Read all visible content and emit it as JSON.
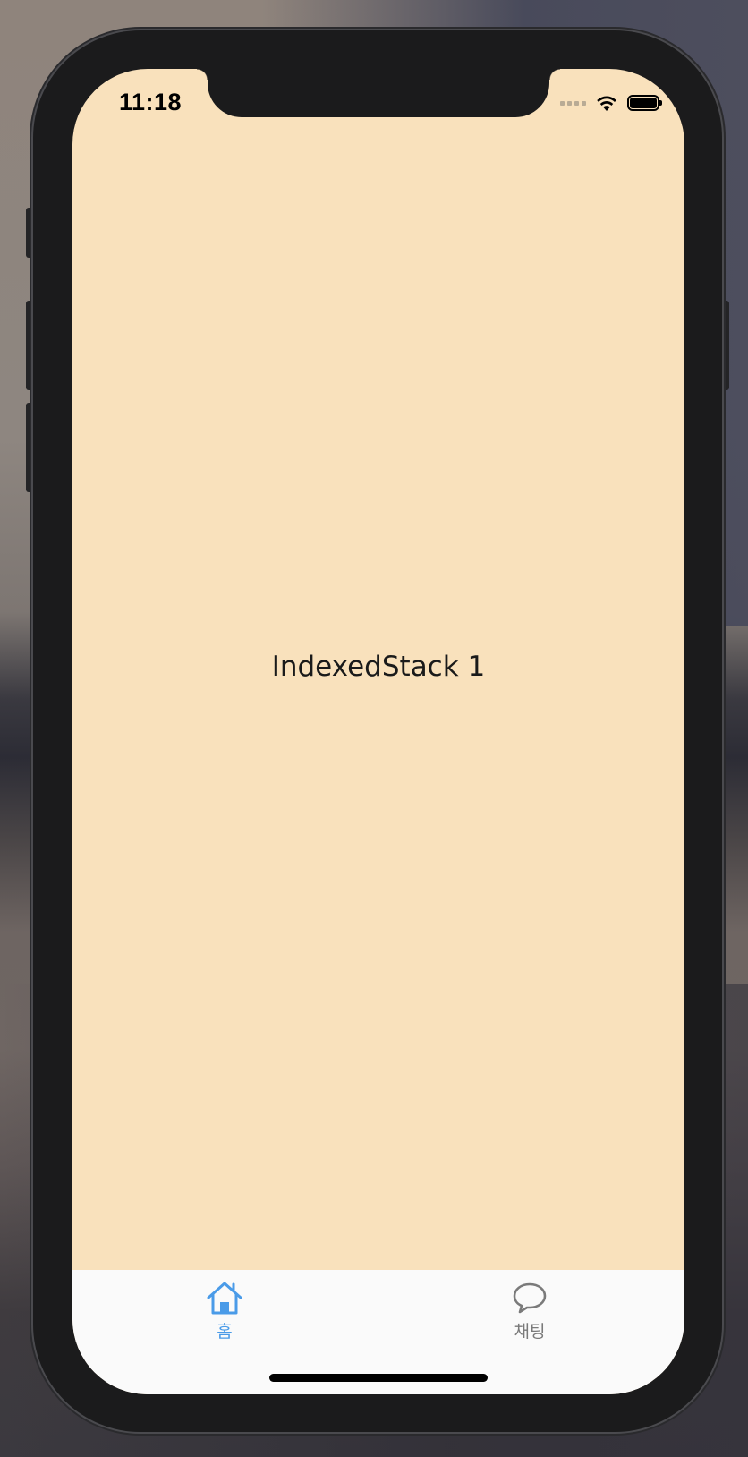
{
  "status_bar": {
    "time": "11:18",
    "icons": [
      "cellular-signal-icon",
      "wifi-icon",
      "battery-icon"
    ]
  },
  "main": {
    "label": "IndexedStack 1",
    "background_color": "#f9e1bc"
  },
  "tabbar": {
    "items": [
      {
        "label": "홈",
        "icon": "home-icon",
        "selected": true,
        "color": "#4a9be8"
      },
      {
        "label": "채팅",
        "icon": "chat-bubble-icon",
        "selected": false,
        "color": "#7a7a7a"
      }
    ]
  }
}
